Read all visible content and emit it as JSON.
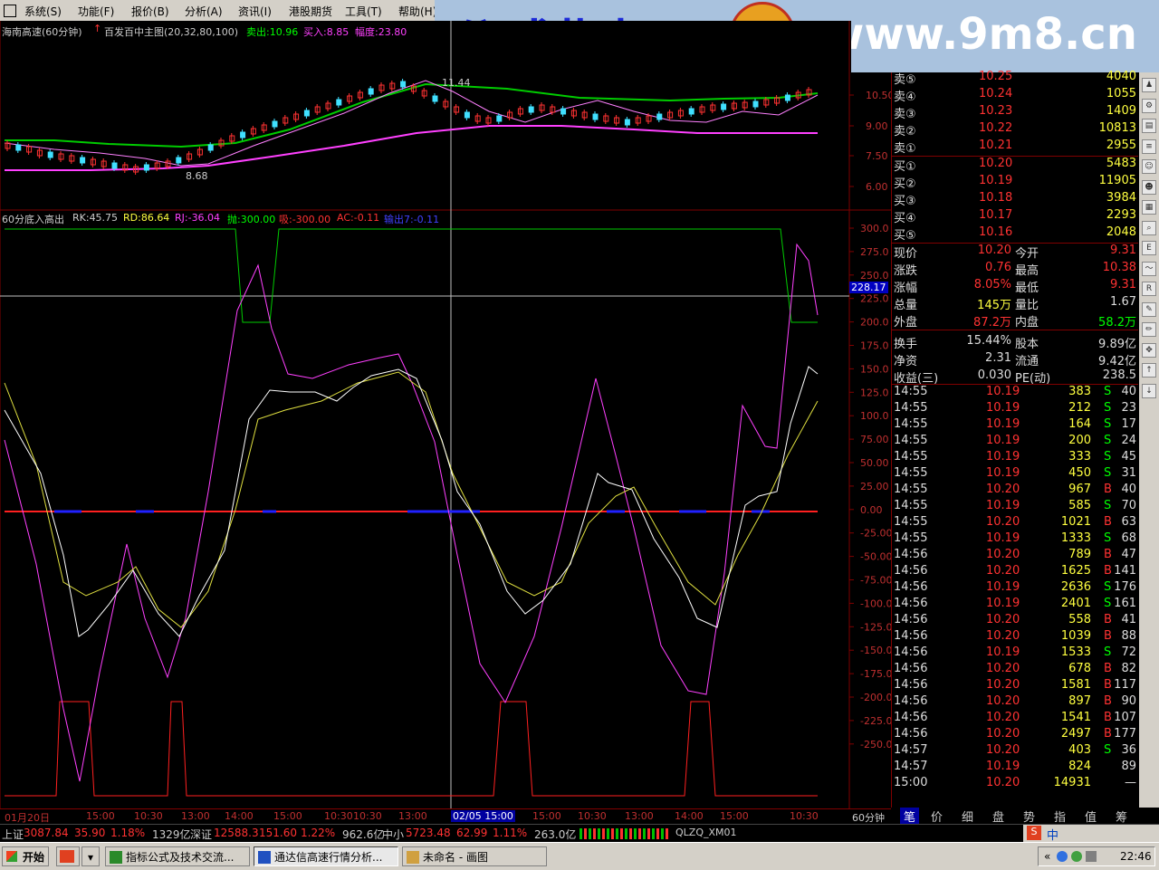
{
  "menu": [
    "系统(S)",
    "功能(F)",
    "报价(B)",
    "分析(A)",
    "资讯(I)",
    "港股期货",
    "工具(T)",
    "帮助(H)"
  ],
  "banner": {
    "title": "公式指标网",
    "url": "www.9m8.cn",
    "logo_char": "实"
  },
  "main_chart": {
    "stock": "海南高速(60分钟)",
    "indicator": "百发百中主图(20,32,80,100)",
    "sell_label": "卖出:10.96",
    "buy_label": "买入:8.85",
    "range_label": "幅度:23.80",
    "high_mark": "11.44",
    "low_mark": "8.68",
    "y_ticks": [
      "10.50",
      "9.00",
      "7.50",
      "6.00"
    ]
  },
  "sub_chart": {
    "name": "60分底入高出",
    "rk": "RK:45.75",
    "rd": "RD:86.64",
    "rj": "RJ:-36.04",
    "pao": "抛:300.00",
    "xi": "吸:-300.00",
    "ac": "AC:-0.11",
    "out": "输出7:-0.11",
    "cursor_value": "228.17",
    "y_ticks": [
      "300.0",
      "275.0",
      "250.0",
      "225.0",
      "200.0",
      "175.0",
      "150.0",
      "125.0",
      "100.0",
      "75.00",
      "50.00",
      "25.00",
      "0.00",
      "-25.00",
      "-50.00",
      "-75.00",
      "-100.0",
      "-125.0",
      "-150.0",
      "-175.0",
      "-200.0",
      "-225.0",
      "-250.0"
    ]
  },
  "time_axis": {
    "labels": [
      "01月20日",
      "15:00",
      "10:30",
      "13:00",
      "14:00",
      "15:00",
      "10:30",
      "10:30",
      "13:00",
      "14:00",
      "15:00",
      "10:30",
      "13:00",
      "14:00",
      "15:00",
      "10:30"
    ],
    "cursor_date": "02/05 15:00",
    "period": "60分钟"
  },
  "quote": {
    "asks": [
      {
        "label": "卖⑤",
        "price": "10.25",
        "vol": "4040"
      },
      {
        "label": "卖④",
        "price": "10.24",
        "vol": "1055"
      },
      {
        "label": "卖③",
        "price": "10.23",
        "vol": "1409"
      },
      {
        "label": "卖②",
        "price": "10.22",
        "vol": "10813"
      },
      {
        "label": "卖①",
        "price": "10.21",
        "vol": "2955"
      }
    ],
    "bids": [
      {
        "label": "买①",
        "price": "10.20",
        "vol": "5483"
      },
      {
        "label": "买②",
        "price": "10.19",
        "vol": "11905"
      },
      {
        "label": "买③",
        "price": "10.18",
        "vol": "3984"
      },
      {
        "label": "买④",
        "price": "10.17",
        "vol": "2293"
      },
      {
        "label": "买⑤",
        "price": "10.16",
        "vol": "2048"
      }
    ],
    "stats": [
      {
        "l1": "现价",
        "v1": "10.20",
        "l2": "今开",
        "v2": "9.31"
      },
      {
        "l1": "涨跌",
        "v1": "0.76",
        "l2": "最高",
        "v2": "10.38"
      },
      {
        "l1": "涨幅",
        "v1": "8.05%",
        "l2": "最低",
        "v2": "9.31"
      },
      {
        "l1": "总量",
        "v1": "145万",
        "l2": "量比",
        "v2": "1.67"
      },
      {
        "l1": "外盘",
        "v1": "87.2万",
        "l2": "内盘",
        "v2": "58.2万"
      },
      {
        "l1": "换手",
        "v1": "15.44%",
        "l2": "股本",
        "v2": "9.89亿"
      },
      {
        "l1": "净资",
        "v1": "2.31",
        "l2": "流通",
        "v2": "9.42亿"
      },
      {
        "l1": "收益(三)",
        "v1": "0.030",
        "l2": "PE(动)",
        "v2": "238.5"
      }
    ],
    "ticks": [
      [
        "14:55",
        "10.19",
        "383",
        "S",
        "40"
      ],
      [
        "14:55",
        "10.19",
        "212",
        "S",
        "23"
      ],
      [
        "14:55",
        "10.19",
        "164",
        "S",
        "17"
      ],
      [
        "14:55",
        "10.19",
        "200",
        "S",
        "24"
      ],
      [
        "14:55",
        "10.19",
        "333",
        "S",
        "45"
      ],
      [
        "14:55",
        "10.19",
        "450",
        "S",
        "31"
      ],
      [
        "14:55",
        "10.20",
        "967",
        "B",
        "40"
      ],
      [
        "14:55",
        "10.19",
        "585",
        "S",
        "70"
      ],
      [
        "14:55",
        "10.20",
        "1021",
        "B",
        "63"
      ],
      [
        "14:55",
        "10.19",
        "1333",
        "S",
        "68"
      ],
      [
        "14:56",
        "10.20",
        "789",
        "B",
        "47"
      ],
      [
        "14:56",
        "10.20",
        "1625",
        "B",
        "141"
      ],
      [
        "14:56",
        "10.19",
        "2636",
        "S",
        "176"
      ],
      [
        "14:56",
        "10.19",
        "2401",
        "S",
        "161"
      ],
      [
        "14:56",
        "10.20",
        "558",
        "B",
        "41"
      ],
      [
        "14:56",
        "10.20",
        "1039",
        "B",
        "88"
      ],
      [
        "14:56",
        "10.19",
        "1533",
        "S",
        "72"
      ],
      [
        "14:56",
        "10.20",
        "678",
        "B",
        "82"
      ],
      [
        "14:56",
        "10.20",
        "1581",
        "B",
        "117"
      ],
      [
        "14:56",
        "10.20",
        "897",
        "B",
        "90"
      ],
      [
        "14:56",
        "10.20",
        "1541",
        "B",
        "107"
      ],
      [
        "14:56",
        "10.20",
        "2497",
        "B",
        "177"
      ],
      [
        "14:57",
        "10.20",
        "403",
        "S",
        "36"
      ],
      [
        "14:57",
        "10.19",
        "824",
        "",
        "89"
      ],
      [
        "15:00",
        "10.20",
        "14931",
        "",
        "—"
      ]
    ],
    "tabs": [
      "笔",
      "价",
      "细",
      "盘",
      "势",
      "指",
      "值",
      "筹"
    ]
  },
  "status": {
    "sh": "上证",
    "sh_v": "3087.84",
    "sh_c": "35.90",
    "sh_p": "1.18%",
    "sh_a": "1329亿",
    "sz": "深证",
    "sz_v": "12588.3",
    "sz_c": "151.60",
    "sz_p": "1.22%",
    "sz_a": "962.6亿",
    "zx": "中小",
    "zx_v": "5723.48",
    "zx_c": "62.99",
    "zx_p": "1.11%",
    "zx_a": "263.0亿",
    "code": "QLZQ_XM01"
  },
  "taskbar": {
    "start": "开始",
    "tasks": [
      "指标公式及技术交流...",
      "通达信高速行情分析...",
      "未命名 - 画图"
    ],
    "clock": "22:46",
    "ime": "中"
  },
  "colors": {
    "up": "#ff3232",
    "down": "#00ffff",
    "green": "#00cc00",
    "magenta": "#ff40ff",
    "yellow": "#ffff40",
    "grid": "#800000"
  }
}
